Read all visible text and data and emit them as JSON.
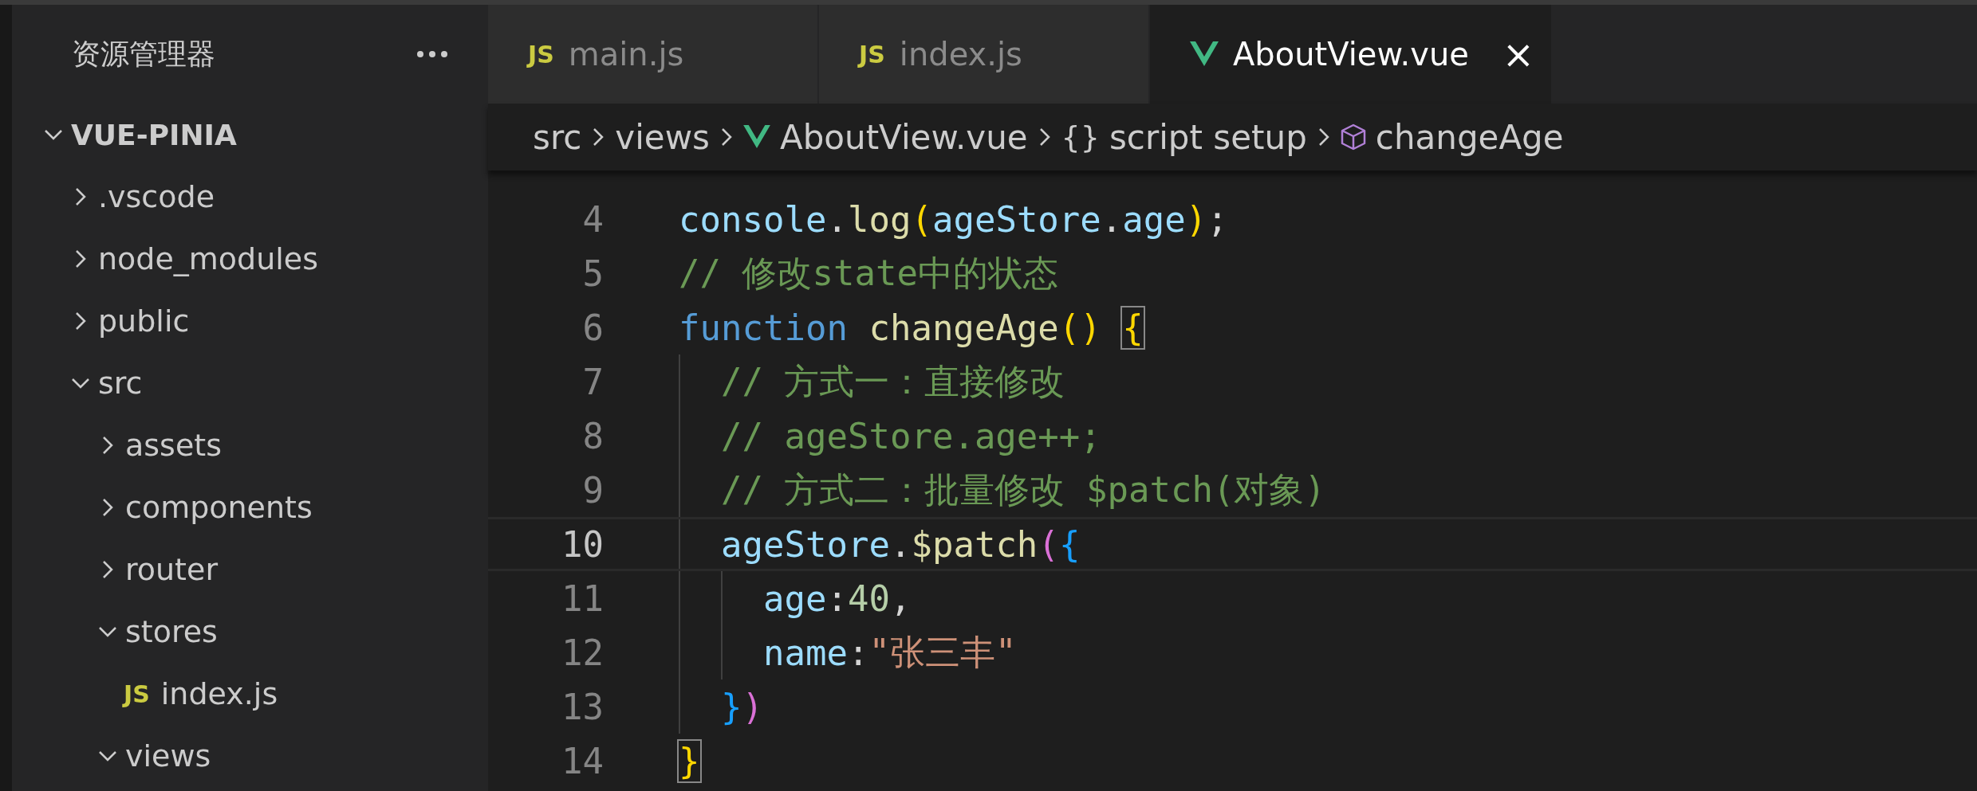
{
  "sidebar": {
    "title": "资源管理器",
    "tree": [
      {
        "label": "VUE-PINIA",
        "kind": "root",
        "expanded": true,
        "children": [
          {
            "label": ".vscode",
            "kind": "folder",
            "expanded": false
          },
          {
            "label": "node_modules",
            "kind": "folder",
            "expanded": false
          },
          {
            "label": "public",
            "kind": "folder",
            "expanded": false
          },
          {
            "label": "src",
            "kind": "folder",
            "expanded": true,
            "children": [
              {
                "label": "assets",
                "kind": "folder",
                "expanded": false
              },
              {
                "label": "components",
                "kind": "folder",
                "expanded": false
              },
              {
                "label": "router",
                "kind": "folder",
                "expanded": false
              },
              {
                "label": "stores",
                "kind": "folder",
                "expanded": true,
                "children": [
                  {
                    "label": "index.js",
                    "kind": "file",
                    "badge": "JS"
                  }
                ]
              },
              {
                "label": "views",
                "kind": "folder",
                "expanded": true
              }
            ]
          }
        ]
      }
    ]
  },
  "tabs": [
    {
      "label": "main.js",
      "kind": "js",
      "badge": "JS",
      "selected": false
    },
    {
      "label": "index.js",
      "kind": "js",
      "badge": "JS",
      "selected": false
    },
    {
      "label": "AboutView.vue",
      "kind": "vue",
      "selected": true,
      "close": "×"
    }
  ],
  "breadcrumb": [
    {
      "label": "src",
      "kind": "folder"
    },
    {
      "label": "views",
      "kind": "folder"
    },
    {
      "label": "AboutView.vue",
      "kind": "vue"
    },
    {
      "label": "script setup",
      "kind": "symbol",
      "glyph": "{}"
    },
    {
      "label": "changeAge",
      "kind": "method"
    }
  ],
  "editor": {
    "lines": [
      {
        "number": "4",
        "current": false,
        "tokens": [
          {
            "text": "console",
            "kind": "variable"
          },
          {
            "text": ".",
            "kind": "punct"
          },
          {
            "text": "log",
            "kind": "function"
          },
          {
            "text": "(",
            "kind": "bracket1"
          },
          {
            "text": "ageStore",
            "kind": "variable"
          },
          {
            "text": ".",
            "kind": "punct"
          },
          {
            "text": "age",
            "kind": "variable"
          },
          {
            "text": ")",
            "kind": "bracket1"
          },
          {
            "text": ";",
            "kind": "punct"
          }
        ]
      },
      {
        "number": "5",
        "current": false,
        "tokens": [
          {
            "text": "// 修改state中的状态",
            "kind": "comment"
          }
        ]
      },
      {
        "number": "6",
        "current": false,
        "tokens": [
          {
            "text": "function",
            "kind": "keyword"
          },
          {
            "text": " changeAge",
            "kind": "function"
          },
          {
            "text": "()",
            "kind": "bracket1"
          },
          {
            "text": " {",
            "kind": "match"
          }
        ]
      },
      {
        "number": "7",
        "current": false,
        "tokens": [
          {
            "text": "  // 方式一：直接修改",
            "kind": "comment"
          }
        ]
      },
      {
        "number": "8",
        "current": false,
        "tokens": [
          {
            "text": "  // ageStore.age++;",
            "kind": "comment"
          }
        ]
      },
      {
        "number": "9",
        "current": false,
        "tokens": [
          {
            "text": "  // 方式二：批量修改 $patch(对象)",
            "kind": "comment"
          }
        ]
      },
      {
        "number": "10",
        "current": true,
        "tokens": [
          {
            "text": "  ageStore",
            "kind": "variable"
          },
          {
            "text": ".",
            "kind": "punct"
          },
          {
            "text": "$patch",
            "kind": "function"
          },
          {
            "text": "(",
            "kind": "bracket2"
          },
          {
            "text": "{",
            "kind": "bracket3"
          }
        ]
      },
      {
        "number": "11",
        "current": false,
        "tokens": [
          {
            "text": "    age",
            "kind": "variable"
          },
          {
            "text": ":",
            "kind": "punct"
          },
          {
            "text": "40",
            "kind": "number"
          },
          {
            "text": ",",
            "kind": "punct"
          }
        ]
      },
      {
        "number": "12",
        "current": false,
        "tokens": [
          {
            "text": "    name",
            "kind": "variable"
          },
          {
            "text": ":",
            "kind": "punct"
          },
          {
            "text": "\"张三丰\"",
            "kind": "string"
          }
        ]
      },
      {
        "number": "13",
        "current": false,
        "tokens": [
          {
            "text": "  }",
            "kind": "bracket3"
          },
          {
            "text": ")",
            "kind": "bracket2"
          }
        ]
      },
      {
        "number": "14",
        "current": false,
        "tokens": [
          {
            "text": "}",
            "kind": "match"
          }
        ]
      }
    ]
  }
}
